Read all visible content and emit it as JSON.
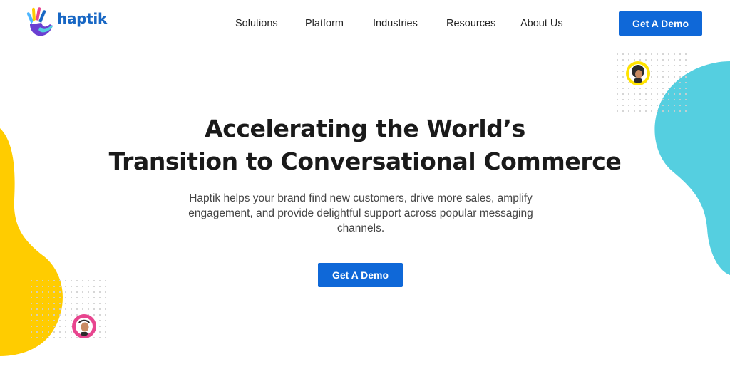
{
  "brand": {
    "name": "haptik",
    "colors": {
      "primary_blue": "#0f68d8",
      "logo_blue": "#1867c4",
      "yellow": "#ffcc00",
      "cyan": "#55cfe0",
      "pink": "#e8458f"
    }
  },
  "nav": {
    "items": [
      {
        "label": "Solutions"
      },
      {
        "label": "Platform"
      },
      {
        "label": "Industries"
      },
      {
        "label": "Resources"
      },
      {
        "label": "About Us"
      }
    ],
    "cta_label": "Get A Demo"
  },
  "hero": {
    "title_line1": "Accelerating the World’s",
    "title_line2": "Transition to Conversational Commerce",
    "subtitle": "Haptik helps your brand find new customers, drive more sales, amplify engagement, and provide delightful support across popular messaging channels.",
    "cta_label": "Get A Demo"
  },
  "decorations": {
    "left_blob_icon": "yellow-blob",
    "right_blob_icon": "cyan-blob",
    "avatar_top_right": "person-avatar-yellow",
    "avatar_bottom_left": "person-avatar-pink"
  }
}
